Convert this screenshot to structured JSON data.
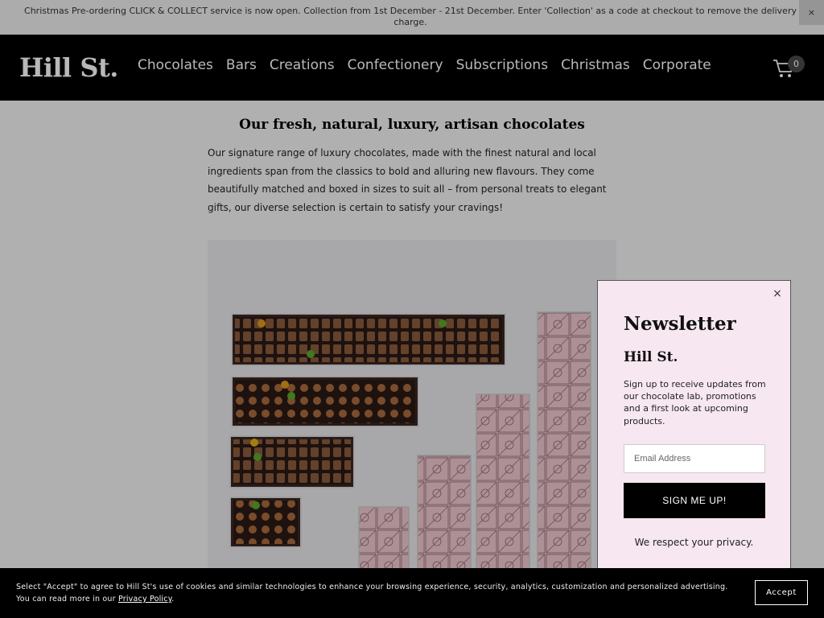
{
  "announcement": {
    "text": "Christmas Pre-ordering CLICK & COLLECT service is now open. Collection from 1st December - 21st December. Enter 'Collection' as a code at checkout to remove the delivery charge.",
    "close_label": "×"
  },
  "header": {
    "logo": "Hill St.",
    "nav": [
      "Chocolates",
      "Bars",
      "Creations",
      "Confectionery",
      "Subscriptions",
      "Christmas",
      "Corporate"
    ],
    "cart_icon": "shopping-cart-icon",
    "cart_count": "0"
  },
  "main": {
    "title": "Our fresh, natural, luxury, artisan chocolates",
    "description": "Our signature range of luxury chocolates, made with the finest natural and local ingredients span from the classics to bold and alluring new flavours. They come beautifully matched and boxed in sizes to suit all – from personal treats to elegant gifts, our diverse selection is certain to satisfy your cravings!"
  },
  "newsletter": {
    "close_label": "×",
    "title": "Newsletter",
    "brand": "Hill St.",
    "text": "Sign up to receive updates from our chocolate lab, promotions and a first look at upcoming products.",
    "email_placeholder": "Email Address",
    "button_label": "SIGN ME UP!",
    "privacy": "We respect your privacy."
  },
  "cookie": {
    "text": "Select \"Accept\" to agree to Hill St's use of cookies and similar technologies to enhance your browsing experience, security, analytics, customization and personalized advertising. You can read more in our ",
    "link": "Privacy Policy",
    "suffix": ".",
    "accept_label": "Accept"
  },
  "colors": {
    "header_bg": "#000000",
    "popup_bg": "#f6e7f0",
    "chocolate_box": "#3a2622",
    "pink_bar": "#f0c8cf"
  }
}
